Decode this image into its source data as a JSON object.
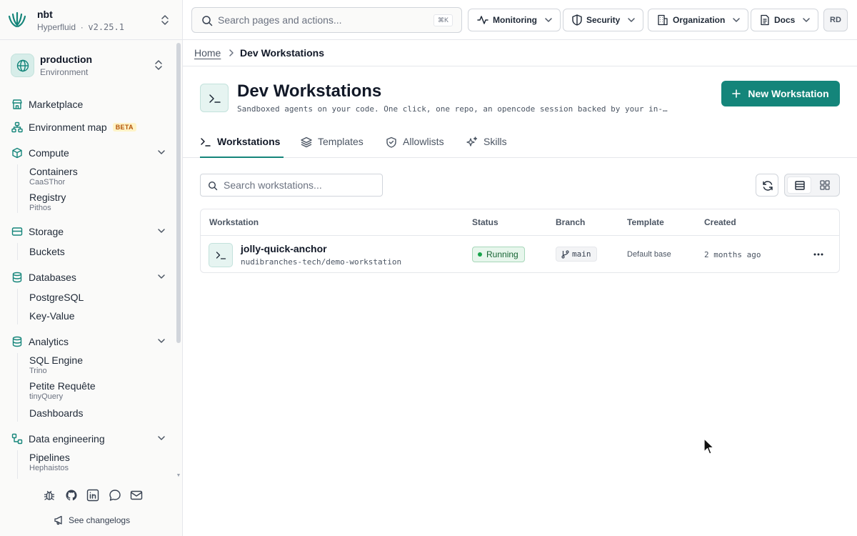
{
  "brand": {
    "name": "nbt",
    "product": "Hyperfluid",
    "separator": "·",
    "version": "v2.25.1",
    "accent": "#14857a"
  },
  "environment": {
    "name": "production",
    "label": "Environment"
  },
  "sidebar": {
    "marketplace": "Marketplace",
    "environment_map": "Environment map",
    "environment_map_badge": "BETA",
    "compute": {
      "label": "Compute",
      "items": [
        {
          "label": "Containers",
          "sub": "CaaSThor"
        },
        {
          "label": "Registry",
          "sub": "Pithos"
        }
      ]
    },
    "storage": {
      "label": "Storage",
      "items": [
        {
          "label": "Buckets"
        }
      ]
    },
    "databases": {
      "label": "Databases",
      "items": [
        {
          "label": "PostgreSQL"
        },
        {
          "label": "Key-Value"
        }
      ]
    },
    "analytics": {
      "label": "Analytics",
      "items": [
        {
          "label": "SQL Engine",
          "sub": "Trino"
        },
        {
          "label": "Petite Requête",
          "sub": "tinyQuery"
        },
        {
          "label": "Dashboards"
        }
      ]
    },
    "data_engineering": {
      "label": "Data engineering",
      "items": [
        {
          "label": "Pipelines",
          "sub": "Hephaistos"
        }
      ]
    },
    "footer_icons": [
      "bug-icon",
      "github-icon",
      "linkedin-icon",
      "chat-icon",
      "mail-icon"
    ],
    "changelog": "See changelogs"
  },
  "topbar": {
    "search_placeholder": "Search pages and actions...",
    "search_shortcut": "⌘K",
    "menus": [
      "Monitoring",
      "Security",
      "Organization",
      "Docs"
    ],
    "avatar": "RD"
  },
  "breadcrumb": {
    "home": "Home",
    "current": "Dev Workstations"
  },
  "page": {
    "title": "Dev Workstations",
    "description": "Sandboxed agents on your code. One click, one repo, an opencode session backed by your in-…",
    "primary_action": "New Workstation"
  },
  "tabs": [
    {
      "label": "Workstations",
      "active": true
    },
    {
      "label": "Templates",
      "active": false
    },
    {
      "label": "Allowlists",
      "active": false
    },
    {
      "label": "Skills",
      "active": false
    }
  ],
  "filters": {
    "search_placeholder": "Search workstations...",
    "view_mode": "list"
  },
  "table": {
    "columns": [
      "Workstation",
      "Status",
      "Branch",
      "Template",
      "Created"
    ],
    "rows": [
      {
        "name": "jolly-quick-anchor",
        "repo": "nudibranches-tech/demo-workstation",
        "status": "Running",
        "branch": "main",
        "template": "Default base",
        "created": "2 months ago"
      }
    ]
  }
}
